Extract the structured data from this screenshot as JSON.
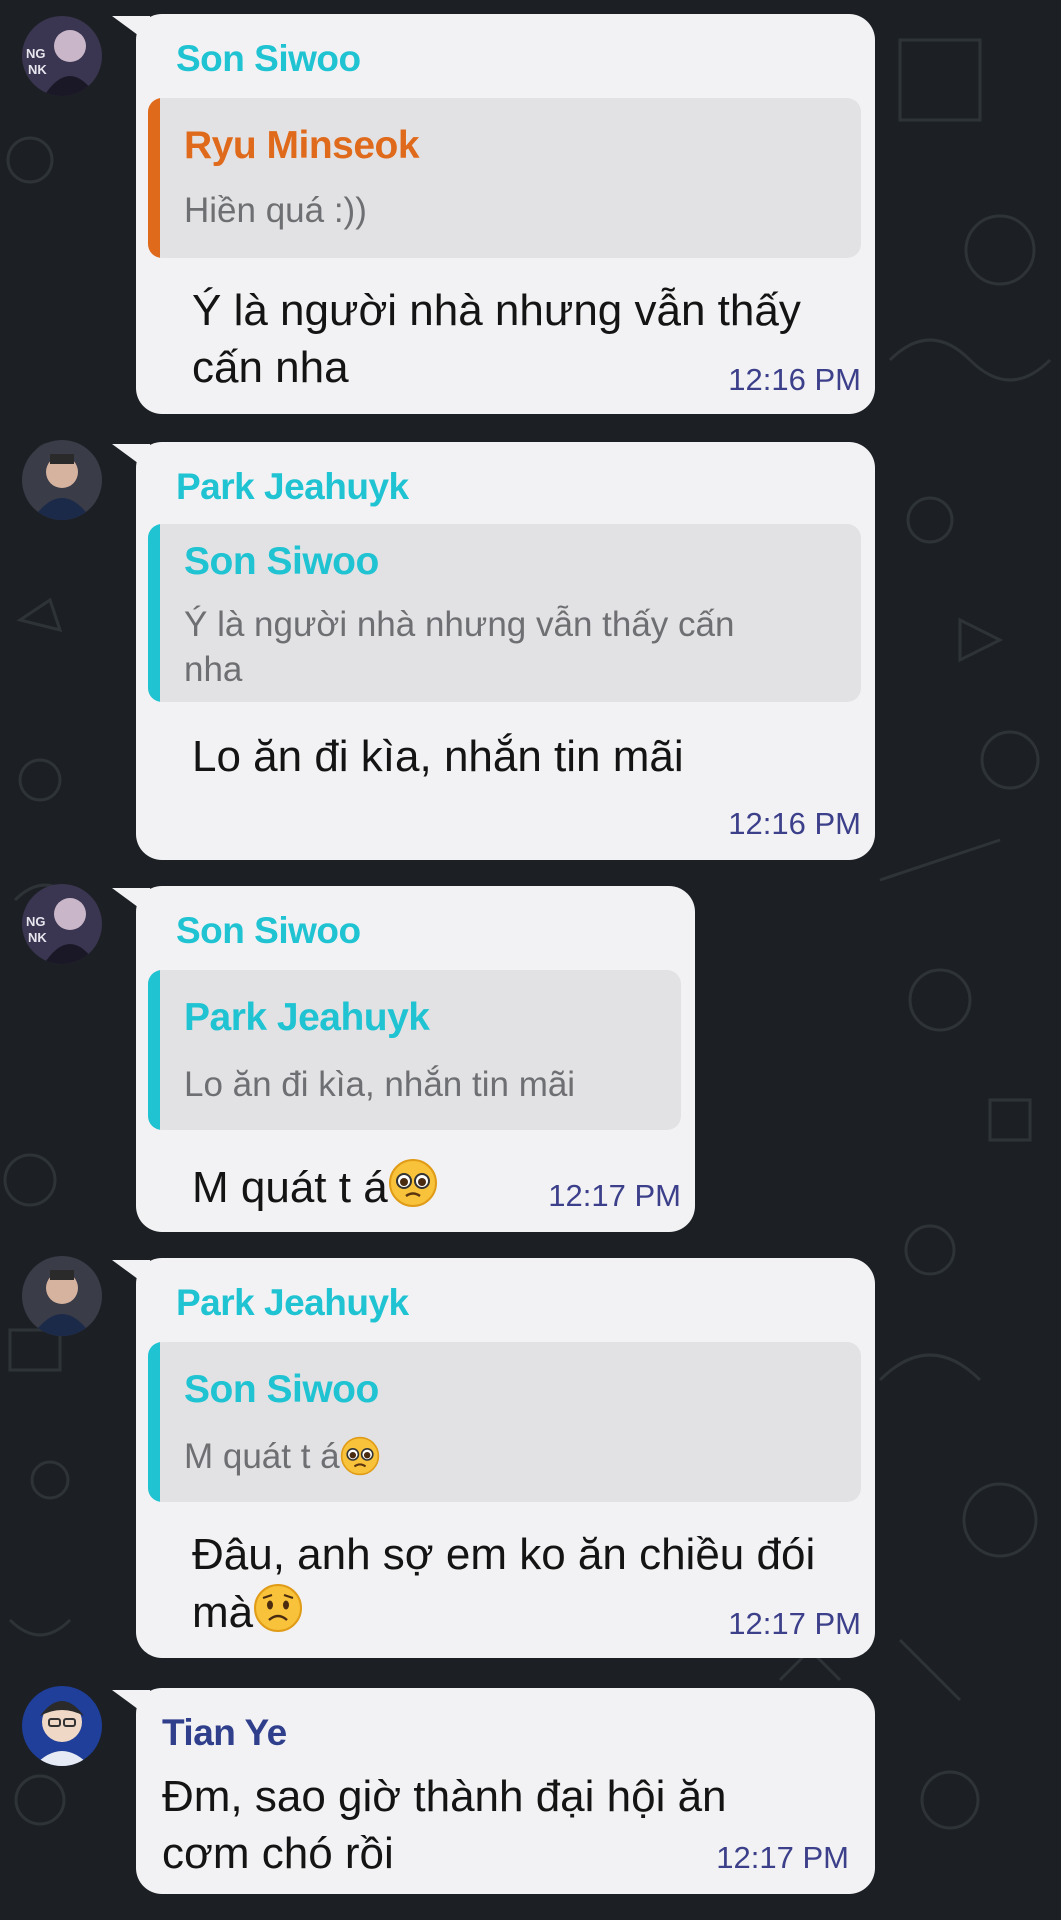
{
  "colors": {
    "background": "#1c2024",
    "bubble": "#f2f2f4",
    "quote_bg": "#e2e2e4",
    "cyan_name": "#1fc3d2",
    "orange_name": "#e06a1b",
    "navy_name": "#2f3f8c",
    "timestamp": "#3c3f8a"
  },
  "messages": [
    {
      "sender": "Son Siwoo",
      "avatar": "son-siwoo-avatar",
      "reply_to": {
        "name": "Ryu Minseok",
        "text": "Hiền quá :))"
      },
      "text_lines": [
        "Ý là người nhà nhưng vẫn thấy",
        "cấn nha"
      ],
      "time": "12:16 PM"
    },
    {
      "sender": "Park Jeahuyk",
      "avatar": "park-jeahuyk-avatar",
      "reply_to": {
        "name": "Son Siwoo",
        "text_lines": [
          "Ý là người nhà nhưng vẫn thấy cấn",
          "nha"
        ]
      },
      "text_lines": [
        "Lo ăn đi kìa, nhắn tin mãi"
      ],
      "time": "12:16 PM"
    },
    {
      "sender": "Son Siwoo",
      "avatar": "son-siwoo-avatar",
      "reply_to": {
        "name": "Park Jeahuyk",
        "text": "Lo ăn đi kìa, nhắn tin mãi"
      },
      "text": "M quát t á",
      "emoji": "pleading-face-emoji",
      "time": "12:17 PM"
    },
    {
      "sender": "Park Jeahuyk",
      "avatar": "park-jeahuyk-avatar",
      "reply_to": {
        "name": "Son Siwoo",
        "text": "M quát t á",
        "emoji": "pleading-face-emoji"
      },
      "text_lines": [
        "Đâu, anh sợ em ko ăn chiều đói",
        "mà"
      ],
      "emoji": "worried-face-emoji",
      "time": "12:17 PM"
    },
    {
      "sender": "Tian Ye",
      "avatar": "tian-ye-avatar",
      "text_lines": [
        "Đm, sao giờ thành đại hội ăn",
        "cơm chó rồi"
      ],
      "time": "12:17 PM"
    }
  ]
}
